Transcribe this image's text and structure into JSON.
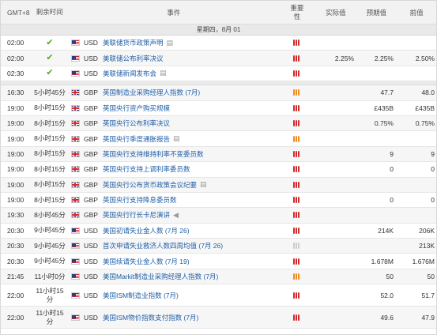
{
  "header": {
    "tz": "GMT+8",
    "remaining": "剩余时间",
    "event": "事件",
    "importance": "重要性",
    "actual": "实际值",
    "forecast": "预期值",
    "previous": "前值"
  },
  "date_label": "星期四，8月 01",
  "colors": {
    "link": "#1f5fa8",
    "high": "#d0282d",
    "medium": "#f08b20",
    "low": "#cccccc",
    "check": "#55a827"
  },
  "rows": [
    {
      "time": "02:00",
      "left": "",
      "left2": "",
      "done": true,
      "flag": "us",
      "currency": "USD",
      "event": "美联储货币政策声明",
      "icon": "doc-icon",
      "imp": "high",
      "actual": "",
      "forecast": "",
      "previous": ""
    },
    {
      "time": "02:00",
      "left": "",
      "left2": "",
      "done": true,
      "flag": "us",
      "currency": "USD",
      "event": "美联储公布利率决议",
      "icon": "",
      "imp": "high",
      "actual": "2.25%",
      "forecast": "2.25%",
      "previous": "2.50%"
    },
    {
      "time": "02:30",
      "left": "",
      "left2": "",
      "done": true,
      "flag": "us",
      "currency": "USD",
      "event": "美联储新闻发布会",
      "icon": "doc-icon",
      "imp": "high",
      "actual": "",
      "forecast": "",
      "previous": ""
    },
    {
      "time": "16:30",
      "left": "5小时45分",
      "left2": "",
      "done": false,
      "flag": "gb",
      "currency": "GBP",
      "event": "英国制造业采购经理人指数 (7月)",
      "icon": "",
      "imp": "medium",
      "actual": "",
      "forecast": "47.7",
      "previous": "48.0"
    },
    {
      "time": "19:00",
      "left": "8小时15分",
      "left2": "",
      "done": false,
      "flag": "gb",
      "currency": "GBP",
      "event": "英国央行资产购买规模",
      "icon": "",
      "imp": "high",
      "actual": "",
      "forecast": "£435B",
      "previous": "£435B"
    },
    {
      "time": "19:00",
      "left": "8小时15分",
      "left2": "",
      "done": false,
      "flag": "gb",
      "currency": "GBP",
      "event": "英国央行公布利率决议",
      "icon": "",
      "imp": "high",
      "actual": "",
      "forecast": "0.75%",
      "previous": "0.75%"
    },
    {
      "time": "19:00",
      "left": "8小时15分",
      "left2": "",
      "done": false,
      "flag": "gb",
      "currency": "GBP",
      "event": "英国央行季度通胀报告",
      "icon": "doc-icon",
      "imp": "medium",
      "actual": "",
      "forecast": "",
      "previous": ""
    },
    {
      "time": "19:00",
      "left": "8小时15分",
      "left2": "",
      "done": false,
      "flag": "gb",
      "currency": "GBP",
      "event": "英国央行支持维持利率不变委员数",
      "icon": "",
      "imp": "high",
      "actual": "",
      "forecast": "9",
      "previous": "9"
    },
    {
      "time": "19:00",
      "left": "8小时15分",
      "left2": "",
      "done": false,
      "flag": "gb",
      "currency": "GBP",
      "event": "英国央行支持上调利率委员数",
      "icon": "",
      "imp": "high",
      "actual": "",
      "forecast": "0",
      "previous": "0"
    },
    {
      "time": "19:00",
      "left": "8小时15分",
      "left2": "",
      "done": false,
      "flag": "gb",
      "currency": "GBP",
      "event": "英国央行公布货币政策会议纪要",
      "icon": "doc-icon",
      "imp": "high",
      "actual": "",
      "forecast": "",
      "previous": ""
    },
    {
      "time": "19:00",
      "left": "8小时15分",
      "left2": "",
      "done": false,
      "flag": "gb",
      "currency": "GBP",
      "event": "英国央行支持降息委员数",
      "icon": "",
      "imp": "high",
      "actual": "",
      "forecast": "0",
      "previous": "0"
    },
    {
      "time": "19:30",
      "left": "8小时45分",
      "left2": "",
      "done": false,
      "flag": "gb",
      "currency": "GBP",
      "event": "英国央行行长卡尼演讲",
      "icon": "speaker-icon",
      "imp": "high",
      "actual": "",
      "forecast": "",
      "previous": ""
    },
    {
      "time": "20:30",
      "left": "9小时45分",
      "left2": "",
      "done": false,
      "flag": "us",
      "currency": "USD",
      "event": "美国初请失业金人数 (7月 26)",
      "icon": "",
      "imp": "high",
      "actual": "",
      "forecast": "214K",
      "previous": "206K"
    },
    {
      "time": "20:30",
      "left": "9小时45分",
      "left2": "",
      "done": false,
      "flag": "us",
      "currency": "USD",
      "event": "首次申请失业救济人数四周均值 (7月 26)",
      "icon": "",
      "imp": "low",
      "actual": "",
      "forecast": "",
      "previous": "213K"
    },
    {
      "time": "20:30",
      "left": "9小时45分",
      "left2": "",
      "done": false,
      "flag": "us",
      "currency": "USD",
      "event": "美国续请失业金人数 (7月 19)",
      "icon": "",
      "imp": "high",
      "actual": "",
      "forecast": "1.678M",
      "previous": "1.676M"
    },
    {
      "time": "21:45",
      "left": "11小时0分",
      "left2": "",
      "done": false,
      "flag": "us",
      "currency": "USD",
      "event": "美国Markit制造业采购经理人指数 (7月)",
      "icon": "",
      "imp": "medium",
      "actual": "",
      "forecast": "50",
      "previous": "50"
    },
    {
      "time": "22:00",
      "left": "11小时15",
      "left2": "分",
      "done": false,
      "flag": "us",
      "currency": "USD",
      "event": "美国ISM制造业指数 (7月)",
      "icon": "",
      "imp": "high",
      "actual": "",
      "forecast": "52.0",
      "previous": "51.7"
    },
    {
      "time": "22:00",
      "left": "11小时15",
      "left2": "分",
      "done": false,
      "flag": "us",
      "currency": "USD",
      "event": "美国ISM物价指数支付指数 (7月)",
      "icon": "",
      "imp": "high",
      "actual": "",
      "forecast": "49.6",
      "previous": "47.9"
    }
  ]
}
